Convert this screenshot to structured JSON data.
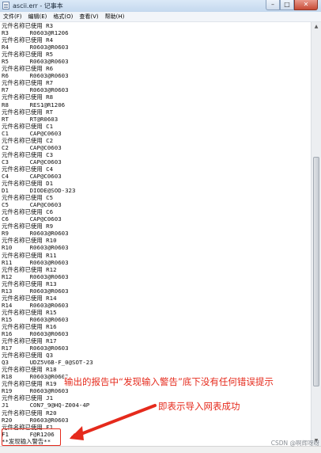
{
  "window": {
    "title": "ascii.err - 记事本",
    "minimize": "–",
    "maximize": "□",
    "close": "✕"
  },
  "menu": [
    "文件(F)",
    "编辑(E)",
    "格式(O)",
    "查看(V)",
    "帮助(H)"
  ],
  "lines": [
    "元件名称已使用 R3",
    "R3      R0603@R1206",
    "元件名称已使用 R4",
    "R4      R0603@R0603",
    "元件名称已使用 R5",
    "R5      R0603@R0603",
    "元件名称已使用 R6",
    "R6      R0603@R0603",
    "元件名称已使用 R7",
    "R7      R0603@R0603",
    "元件名称已使用 R8",
    "R8      RES1@R1206",
    "元件名称已使用 RT",
    "RT      RT@R0603",
    "元件名称已使用 C1",
    "C1      CAP@C0603",
    "元件名称已使用 C2",
    "C2      CAP@C0603",
    "元件名称已使用 C3",
    "C3      CAP@C0603",
    "元件名称已使用 C4",
    "C4      CAP@C0603",
    "元件名称已使用 D1",
    "D1      DIODE@SOD-323",
    "元件名称已使用 C5",
    "C5      CAP@C0603",
    "元件名称已使用 C6",
    "C6      CAP@C0603",
    "元件名称已使用 R9",
    "R9      R0603@R0603",
    "元件名称已使用 R10",
    "R10     R0603@R0603",
    "元件名称已使用 R11",
    "R11     R0603@R0603",
    "元件名称已使用 R12",
    "R12     R0603@R0603",
    "元件名称已使用 R13",
    "R13     R0603@R0603",
    "元件名称已使用 R14",
    "R14     R0603@R0603",
    "元件名称已使用 R15",
    "R15     R0603@R0603",
    "元件名称已使用 R16",
    "R16     R0603@R0603",
    "元件名称已使用 R17",
    "R17     R0603@R0603",
    "元件名称已使用 Q3",
    "Q3      UDZ5V6B-F_0@SOT-23",
    "元件名称已使用 R18",
    "R18     R0603@R0603",
    "元件名称已使用 R19",
    "R19     R0603@R0603",
    "元件名称已使用 J1",
    "J1      CON7_9@HQ-Z004-4P",
    "元件名称已使用 R20",
    "R20     R0603@R0603",
    "元件名称已使用 F1",
    "F1      F@R1206",
    "**发现输入警告**"
  ],
  "annotations": {
    "line1": "输出的报告中“发现输入警告”底下没有任何错误提示",
    "line2": "即表示导入网表成功"
  },
  "watermark": "CSDN @啊辉呀呀",
  "colors": {
    "annotation": "#e52a1c",
    "title_bar": "#c4d8ee"
  }
}
